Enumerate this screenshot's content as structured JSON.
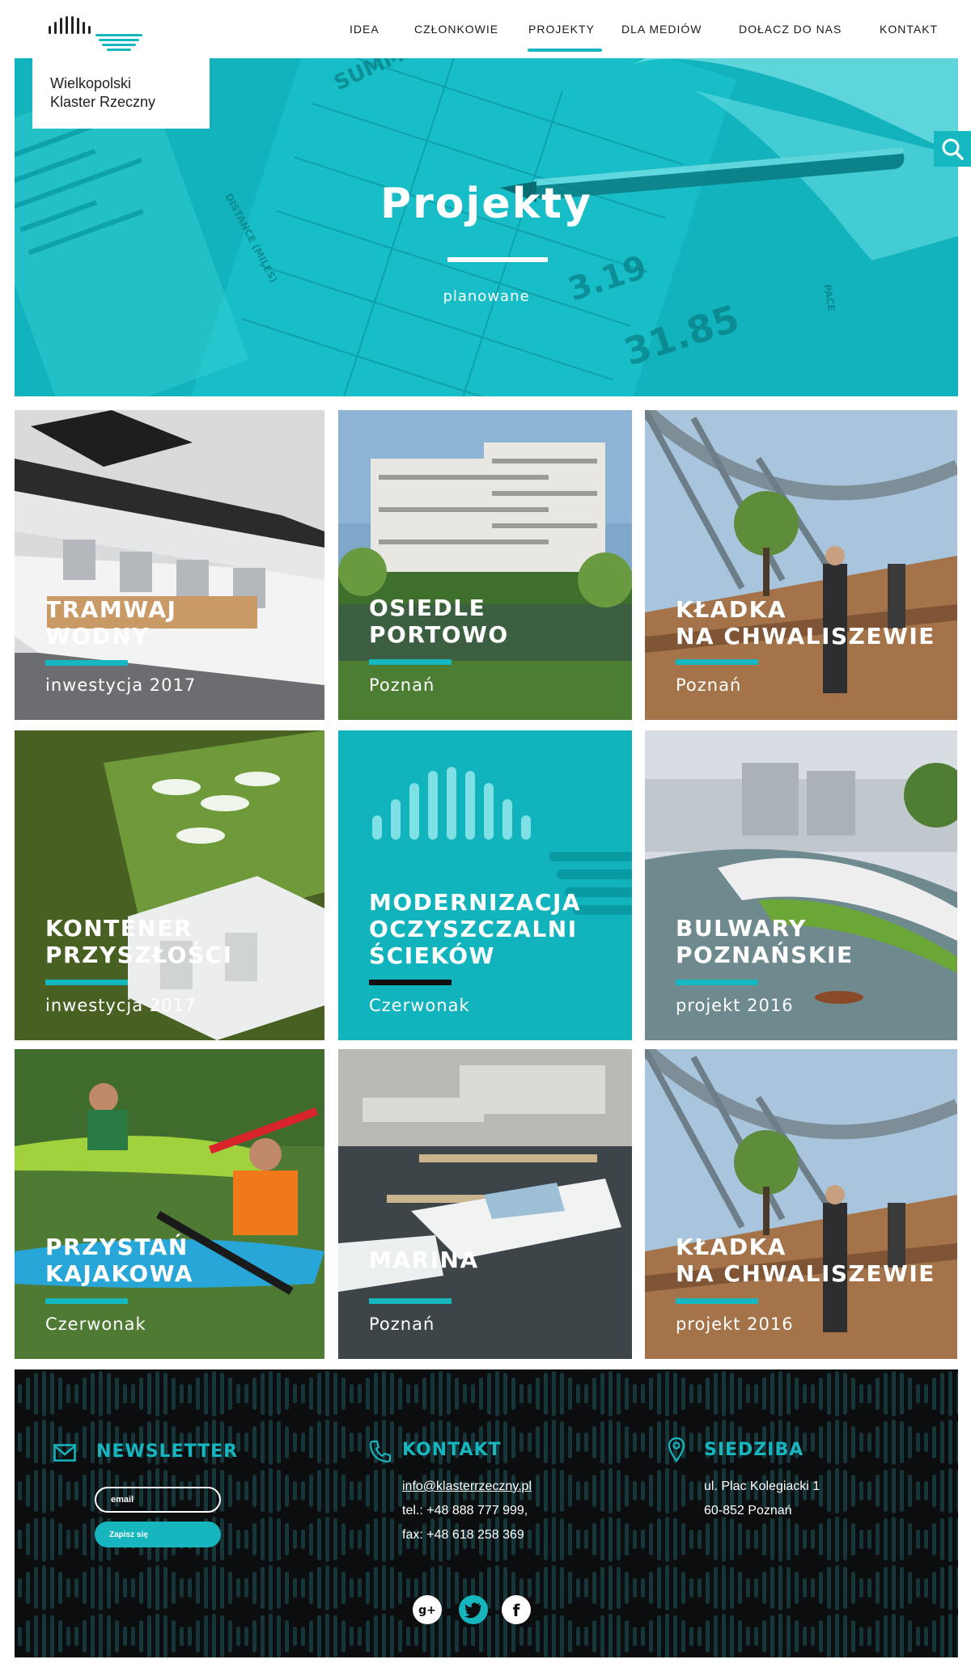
{
  "brand": {
    "name_line1": "Wielkopolski",
    "name_line2": "Klaster Rzeczny",
    "accent_color": "#15b8c0"
  },
  "nav": {
    "items": [
      "IDEA",
      "CZŁONKOWIE",
      "PROJEKTY",
      "DLA MEDIÓW",
      "DOŁACZ DO NAS",
      "KONTAKT"
    ],
    "active": "PROJEKTY"
  },
  "hero": {
    "title": "Projekty",
    "subtitle": "planowane",
    "background_numbers": [
      "SUMMARY",
      "3.19",
      "31.85",
      "DISTANCE (MILES)",
      "PACE"
    ]
  },
  "projects": [
    {
      "title_line1": "TRAMWAJ",
      "title_line2": "WODNY",
      "title_line3": "",
      "subtitle": "inwestycja 2017"
    },
    {
      "title_line1": "OSIEDLE",
      "title_line2": "PORTOWO",
      "title_line3": "",
      "subtitle": "Poznań"
    },
    {
      "title_line1": "KŁADKA",
      "title_line2": "NA CHWALISZEWIE",
      "title_line3": "",
      "subtitle": "Poznań"
    },
    {
      "title_line1": "KONTENER",
      "title_line2": "PRZYSZŁOŚCI",
      "title_line3": "",
      "subtitle": "inwestycja 2017"
    },
    {
      "title_line1": "MODERNIZACJA",
      "title_line2": "OCZYSZCZALNI",
      "title_line3": "ŚCIEKÓW",
      "subtitle": "Czerwonak"
    },
    {
      "title_line1": "BULWARY",
      "title_line2": "POZNAŃSKIE",
      "title_line3": "",
      "subtitle": "projekt 2016"
    },
    {
      "title_line1": "PRZYSTAŃ",
      "title_line2": "KAJAKOWA",
      "title_line3": "",
      "subtitle": "Czerwonak"
    },
    {
      "title_line1": "MARINA",
      "title_line2": "",
      "title_line3": "",
      "subtitle": "Poznań"
    },
    {
      "title_line1": "KŁADKA",
      "title_line2": "NA CHWALISZEWIE",
      "title_line3": "",
      "subtitle": "projekt 2016"
    }
  ],
  "footer": {
    "newsletter": {
      "heading": "NEWSLETTER",
      "email_placeholder": "email",
      "button_label": "Zapisz się"
    },
    "contact": {
      "heading": "KONTAKT",
      "email": "info@klasterrzeczny.pl",
      "phone": "tel.: +48 888 777 999,",
      "fax": "fax: +48 618 258 369"
    },
    "office": {
      "heading": "SIEDZIBA",
      "address_line1": "ul. Plac Kolegiacki 1",
      "address_line2": "60-852 Poznań"
    },
    "social": [
      {
        "icon": "google-plus-icon",
        "label": "g+"
      },
      {
        "icon": "twitter-icon",
        "label": ""
      },
      {
        "icon": "facebook-icon",
        "label": "f"
      }
    ]
  }
}
